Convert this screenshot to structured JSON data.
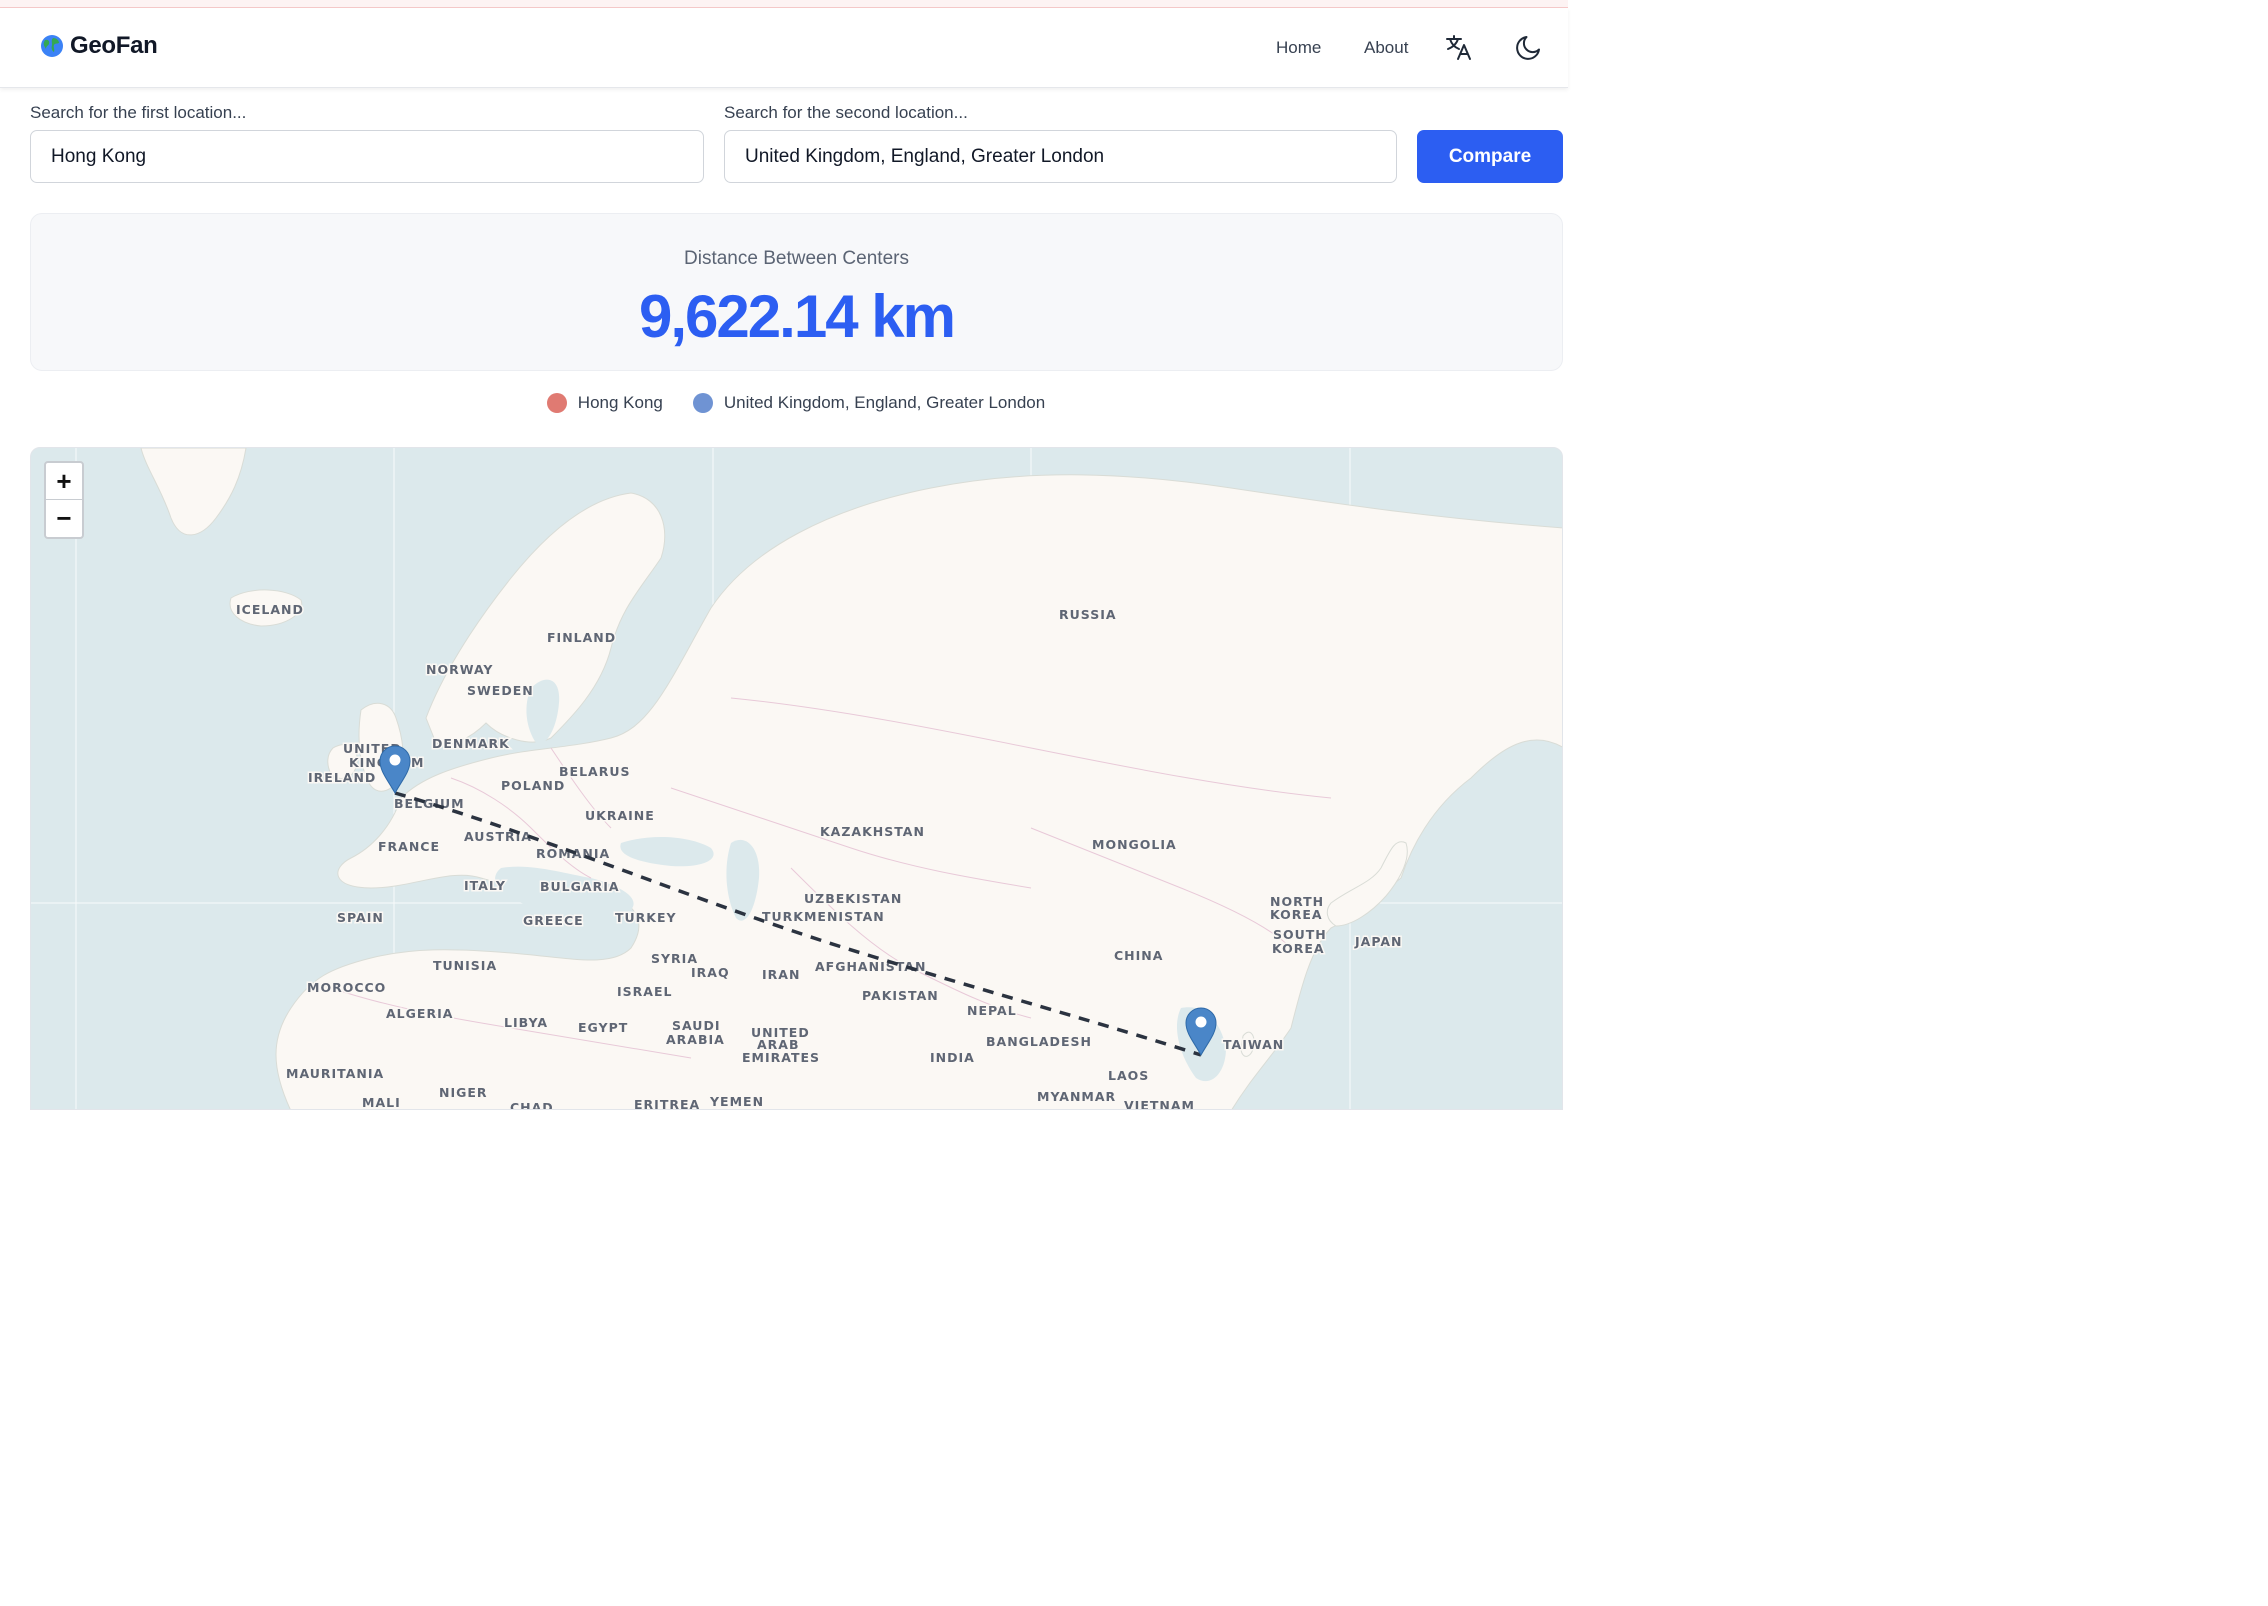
{
  "app": {
    "name": "GeoFan",
    "logo_icon": "globe-icon"
  },
  "nav": {
    "links": [
      {
        "label": "Home"
      },
      {
        "label": "About"
      }
    ],
    "icons": [
      "translate-icon",
      "moon-icon"
    ]
  },
  "search": {
    "first": {
      "label": "Search for the first location...",
      "value": "Hong Kong"
    },
    "second": {
      "label": "Search for the second location...",
      "value": "United Kingdom, England, Greater London"
    },
    "compare_label": "Compare"
  },
  "distance": {
    "label": "Distance Between Centers",
    "value": "9,622.14 km"
  },
  "legend": [
    {
      "label": "Hong Kong",
      "color": "#e07a72"
    },
    {
      "label": "United Kingdom, England, Greater London",
      "color": "#6f93d3"
    }
  ],
  "map": {
    "zoom_in": "+",
    "zoom_out": "−",
    "colors": {
      "water": "#dce9ec",
      "land": "#fbf8f4",
      "border": "#e8c9d8",
      "line": "#2b3340",
      "marker": "#4a86c8"
    },
    "countries": [
      "ICELAND",
      "FINLAND",
      "NORWAY",
      "SWEDEN",
      "DENMARK",
      "UNITED",
      "KINGDOM",
      "IRELAND",
      "BELARUS",
      "POLAND",
      "BELGIUM",
      "UKRAINE",
      "AUSTRIA",
      "FRANCE",
      "ROMANIA",
      "ITALY",
      "BULGARIA",
      "SPAIN",
      "GREECE",
      "TURKEY",
      "TUNISIA",
      "SYRIA",
      "IRAQ",
      "IRAN",
      "MOROCCO",
      "ISRAEL",
      "ALGERIA",
      "LIBYA",
      "EGYPT",
      "SAUDI",
      "ARABIA",
      "UNITED",
      "ARAB",
      "EMIRATES",
      "MAURITANIA",
      "MALI",
      "NIGER",
      "CHAD",
      "ERITREA",
      "YEMEN",
      "RUSSIA",
      "KAZAKHSTAN",
      "MONGOLIA",
      "UZBEKISTAN",
      "TURKMENISTAN",
      "AFGHANISTAN",
      "PAKISTAN",
      "NEPAL",
      "INDIA",
      "BANGLADESH",
      "CHINA",
      "NORTH",
      "KOREA",
      "SOUTH",
      "KOREA",
      "JAPAN",
      "TAIWAN",
      "LAOS",
      "MYANMAR",
      "VIETNAM"
    ]
  }
}
